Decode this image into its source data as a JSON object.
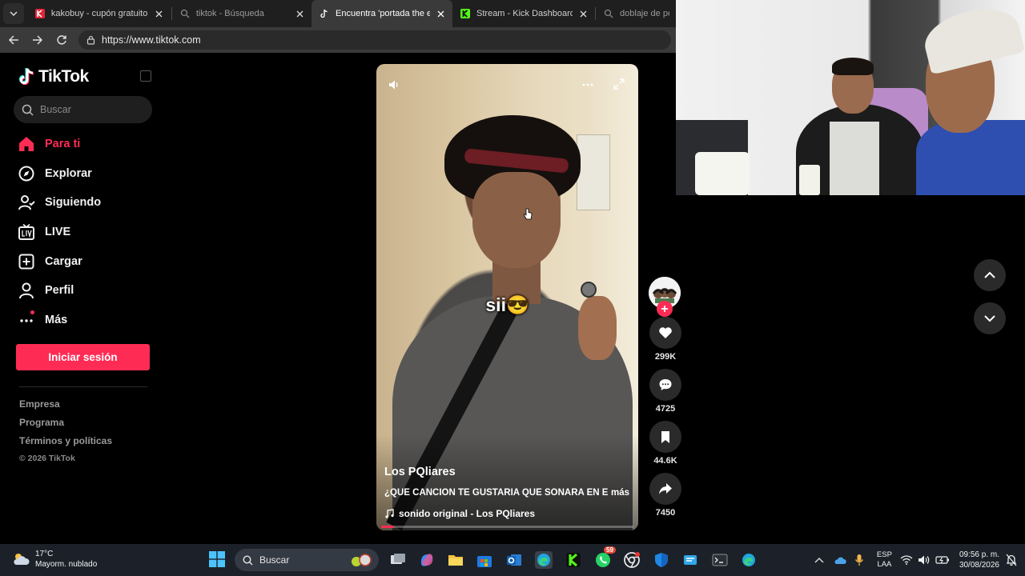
{
  "browser": {
    "tabs": [
      {
        "title": "kakobuy - cupón gratuito de",
        "favicon_color": "#e1253a",
        "active": false
      },
      {
        "title": "tiktok - Búsqueda",
        "favicon_color": "#888888",
        "active": false
      },
      {
        "title": "Encuentra 'portada the econ",
        "favicon_color": "#ffffff",
        "active": true
      },
      {
        "title": "Stream - Kick Dashboard",
        "favicon_color": "#53fc18",
        "active": false
      },
      {
        "title": "doblaje de pelic",
        "favicon_color": "#888888",
        "active": false
      }
    ],
    "url": "https://www.tiktok.com"
  },
  "tiktok": {
    "logo": "TikTok",
    "search_placeholder": "Buscar",
    "nav": [
      {
        "label": "Para ti",
        "icon": "home-icon",
        "active": true
      },
      {
        "label": "Explorar",
        "icon": "compass-icon",
        "active": false
      },
      {
        "label": "Siguiendo",
        "icon": "following-icon",
        "active": false
      },
      {
        "label": "LIVE",
        "icon": "live-icon",
        "active": false
      },
      {
        "label": "Cargar",
        "icon": "upload-icon",
        "active": false
      },
      {
        "label": "Perfil",
        "icon": "profile-icon",
        "active": false
      },
      {
        "label": "Más",
        "icon": "more-icon",
        "active": false
      }
    ],
    "login_label": "Iniciar sesión",
    "footer": [
      "Empresa",
      "Programa",
      "Términos y políticas"
    ],
    "copyright": "© 2026 TikTok",
    "accent": "#fe2c55"
  },
  "video": {
    "caption": "sii😎",
    "author": "Los PQliares",
    "description": "¿QUÉ CANCIÓN TE GUSTARÍA QUE SONARA EN EL",
    "more_label": "más",
    "music": "sonido original - Los PQliares",
    "progress": 0.05
  },
  "actions": {
    "likes": "299K",
    "comments": "4725",
    "saves": "44.6K",
    "shares": "7450"
  },
  "taskbar": {
    "temperature": "17°C",
    "weather": "Mayorm. nublado",
    "search_label": "Buscar",
    "whatsapp_badge": "59",
    "lang_1": "ESP",
    "lang_2": "LAA",
    "time": "09:56 p. m.",
    "date": "30/08/2026"
  }
}
